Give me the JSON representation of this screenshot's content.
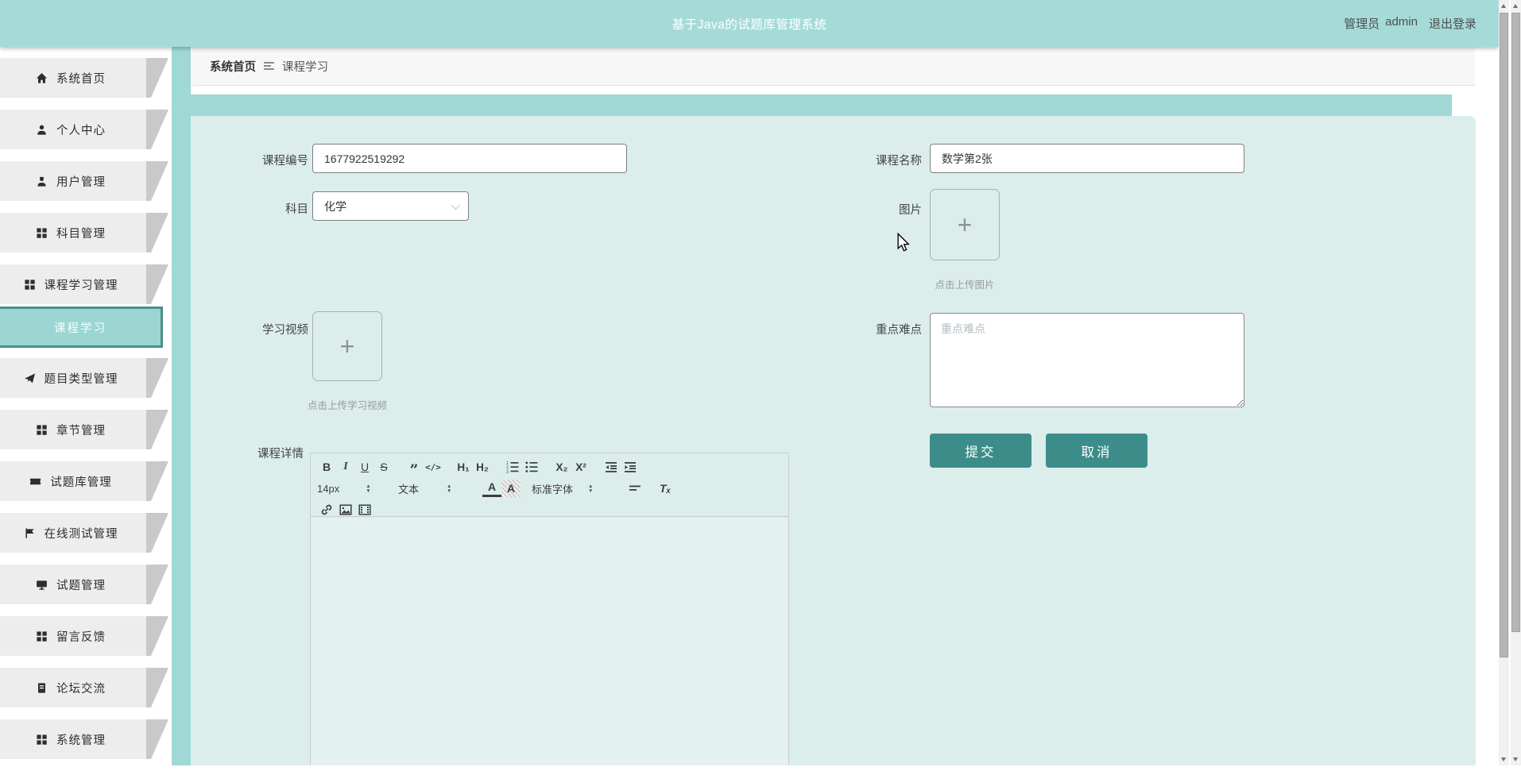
{
  "header": {
    "title": "基于Java的试题库管理系统",
    "role": "管理员",
    "username": "admin",
    "logout": "退出登录"
  },
  "breadcrumb": {
    "home": "系统首页",
    "current": "课程学习"
  },
  "sidebar": {
    "items": [
      {
        "label": "系统首页",
        "icon": "home-icon",
        "active": false
      },
      {
        "label": "个人中心",
        "icon": "user-icon",
        "active": false
      },
      {
        "label": "用户管理",
        "icon": "user-solid-icon",
        "active": false
      },
      {
        "label": "科目管理",
        "icon": "grid-icon",
        "active": false
      },
      {
        "label": "课程学习管理",
        "icon": "grid-icon",
        "active": false
      },
      {
        "label": "课程学习",
        "icon": null,
        "active": true
      },
      {
        "label": "题目类型管理",
        "icon": "paper-plane-icon",
        "active": false
      },
      {
        "label": "章节管理",
        "icon": "grid-icon",
        "active": false
      },
      {
        "label": "试题库管理",
        "icon": "ticket-icon",
        "active": false
      },
      {
        "label": "在线测试管理",
        "icon": "flag-icon",
        "active": false
      },
      {
        "label": "试题管理",
        "icon": "monitor-icon",
        "active": false
      },
      {
        "label": "留言反馈",
        "icon": "grid-icon",
        "active": false
      },
      {
        "label": "论坛交流",
        "icon": "journal-icon",
        "active": false
      },
      {
        "label": "系统管理",
        "icon": "grid-icon",
        "active": false
      }
    ]
  },
  "form": {
    "course_no": {
      "label": "课程编号",
      "value": "1677922519292"
    },
    "course_name": {
      "label": "课程名称",
      "value": "数学第2张"
    },
    "subject": {
      "label": "科目",
      "value": "化学"
    },
    "image": {
      "label": "图片",
      "hint": "点击上传图片"
    },
    "video": {
      "label": "学习视频",
      "hint": "点击上传学习视频"
    },
    "keypoints": {
      "label": "重点难点",
      "placeholder": "重点难点"
    },
    "detail": {
      "label": "课程详情"
    },
    "submit_label": "提交",
    "cancel_label": "取消"
  },
  "editor": {
    "toolbar": {
      "bold": "B",
      "italic": "I",
      "underline": "U",
      "strike": "S",
      "quote": "”",
      "code": "</>",
      "h1": "H₁",
      "h2": "H₂",
      "sub": "X₂",
      "sup": "X²",
      "size": "14px",
      "text_style": "文本",
      "font": "标准字体",
      "color": "A",
      "background": "A",
      "clear": "Tₓ"
    }
  },
  "icons": {
    "plus": "+"
  },
  "colors": {
    "accent": "#3c8d8a",
    "header_teal": "#a5dbd7",
    "container_teal": "#9fd8d4",
    "panel_mint": "#dbeeec",
    "active_item": "#9bd6d2"
  }
}
